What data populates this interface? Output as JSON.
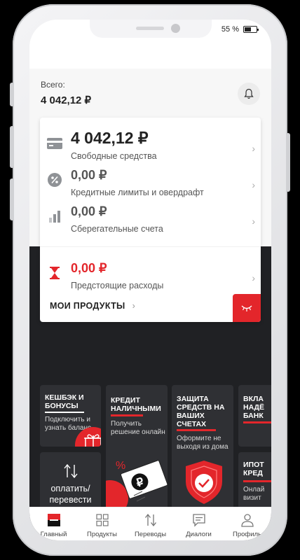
{
  "status_bar": {
    "battery": "55 %"
  },
  "header": {
    "total_label": "Всего:",
    "total_value": "4 042,12 ₽"
  },
  "accounts": [
    {
      "amount": "4 042,12 ₽",
      "label": "Свободные средства",
      "icon": "card-icon"
    },
    {
      "amount": "0,00 ₽",
      "label": "Кредитные лимиты и овердрафт",
      "icon": "percent-icon"
    },
    {
      "amount": "0,00 ₽",
      "label": "Сберегательные счета",
      "icon": "bar-chart-icon"
    },
    {
      "amount": "0,00 ₽",
      "label": "Предстоящие расходы",
      "icon": "hourglass-icon"
    }
  ],
  "my_products": {
    "label": "МОИ ПРОДУКТЫ"
  },
  "tiles": {
    "cashback": {
      "title": "КЕШБЭК И БОНУСЫ",
      "subtitle": "Подключить и узнать баланс"
    },
    "credit": {
      "title": "КРЕДИТ НАЛИЧНЫМИ",
      "subtitle": "Получить решение онлайн"
    },
    "protection": {
      "title": "ЗАЩИТА СРЕДСТВ НА ВАШИХ СЧЕТАХ",
      "subtitle": "Оформите не выходя из дома"
    },
    "deposit": {
      "title": "ВКЛА НАДЁ БАНК"
    },
    "pay": {
      "label": "оплатить/ перевести"
    },
    "mortgage": {
      "title": "ИПОТ КРЕД",
      "subtitle": "Онлай визит"
    }
  },
  "tabbar": [
    {
      "label": "Главный",
      "icon": "home-logo-icon",
      "active": true
    },
    {
      "label": "Продукты",
      "icon": "grid-icon"
    },
    {
      "label": "Переводы",
      "icon": "transfer-arrows-icon"
    },
    {
      "label": "Диалоги",
      "icon": "chat-icon"
    },
    {
      "label": "Профиль",
      "icon": "profile-icon"
    }
  ],
  "colors": {
    "accent": "#e3262b",
    "dark_bg": "#202124",
    "tile_bg": "#2f3034"
  }
}
